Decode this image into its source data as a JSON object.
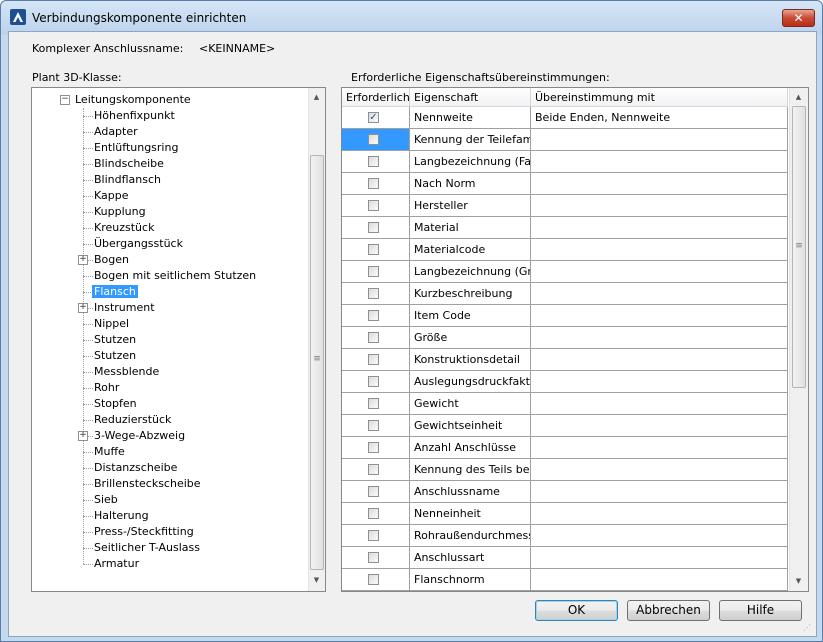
{
  "window": {
    "title": "Verbindungskomponente einrichten",
    "close_glyph": "✕",
    "app_icon": "autocad-plant-icon"
  },
  "header": {
    "name_label": "Komplexer Anschlussname:",
    "name_value": "<KEINNAME>"
  },
  "left_panel": {
    "label": "Plant 3D-Klasse:",
    "root": "Leitungskomponente",
    "items": [
      {
        "label": "Höhenfixpunkt",
        "expandable": false
      },
      {
        "label": "Adapter",
        "expandable": false
      },
      {
        "label": "Entlüftungsring",
        "expandable": false
      },
      {
        "label": "Blindscheibe",
        "expandable": false
      },
      {
        "label": "Blindflansch",
        "expandable": false
      },
      {
        "label": "Kappe",
        "expandable": false
      },
      {
        "label": "Kupplung",
        "expandable": false
      },
      {
        "label": "Kreuzstück",
        "expandable": false
      },
      {
        "label": "Übergangsstück",
        "expandable": false
      },
      {
        "label": "Bogen",
        "expandable": true
      },
      {
        "label": "Bogen mit seitlichem Stutzen",
        "expandable": false
      },
      {
        "label": "Flansch",
        "expandable": false,
        "selected": true
      },
      {
        "label": "Instrument",
        "expandable": true
      },
      {
        "label": "Nippel",
        "expandable": false
      },
      {
        "label": "Stutzen",
        "expandable": false
      },
      {
        "label": "Stutzen",
        "expandable": false
      },
      {
        "label": "Messblende",
        "expandable": false
      },
      {
        "label": "Rohr",
        "expandable": false
      },
      {
        "label": "Stopfen",
        "expandable": false
      },
      {
        "label": "Reduzierstück",
        "expandable": false
      },
      {
        "label": "3-Wege-Abzweig",
        "expandable": true
      },
      {
        "label": "Muffe",
        "expandable": false
      },
      {
        "label": "Distanzscheibe",
        "expandable": false
      },
      {
        "label": "Brillensteckscheibe",
        "expandable": false
      },
      {
        "label": "Sieb",
        "expandable": false
      },
      {
        "label": "Halterung",
        "expandable": false
      },
      {
        "label": "Press-/Steckfitting",
        "expandable": false
      },
      {
        "label": "Seitlicher T-Auslass",
        "expandable": false
      },
      {
        "label": "Armatur",
        "expandable": false
      }
    ]
  },
  "right_panel": {
    "label": "Erforderliche Eigenschaftsübereinstimmungen:",
    "columns": [
      "Erforderlich",
      "Eigenschaft",
      "Übereinstimmung mit"
    ],
    "rows": [
      {
        "required": true,
        "property": "Nennweite",
        "match": "Beide Enden, Nennweite"
      },
      {
        "required": false,
        "property": "Kennung der Teilefami...",
        "match": "",
        "selected": true
      },
      {
        "required": false,
        "property": "Langbezeichnung (Fa...",
        "match": ""
      },
      {
        "required": false,
        "property": "Nach Norm",
        "match": ""
      },
      {
        "required": false,
        "property": "Hersteller",
        "match": ""
      },
      {
        "required": false,
        "property": "Material",
        "match": ""
      },
      {
        "required": false,
        "property": "Materialcode",
        "match": ""
      },
      {
        "required": false,
        "property": "Langbezeichnung (Gr...",
        "match": ""
      },
      {
        "required": false,
        "property": "Kurzbeschreibung",
        "match": ""
      },
      {
        "required": false,
        "property": "Item Code",
        "match": ""
      },
      {
        "required": false,
        "property": "Größe",
        "match": ""
      },
      {
        "required": false,
        "property": "Konstruktionsdetail",
        "match": ""
      },
      {
        "required": false,
        "property": "Auslegungsdruckfaktor",
        "match": ""
      },
      {
        "required": false,
        "property": "Gewicht",
        "match": ""
      },
      {
        "required": false,
        "property": "Gewichtseinheit",
        "match": ""
      },
      {
        "required": false,
        "property": "Anzahl Anschlüsse",
        "match": ""
      },
      {
        "required": false,
        "property": "Kennung des Teils be...",
        "match": ""
      },
      {
        "required": false,
        "property": "Anschlussname",
        "match": ""
      },
      {
        "required": false,
        "property": "Nenneinheit",
        "match": ""
      },
      {
        "required": false,
        "property": "Rohraußendurchmesser",
        "match": ""
      },
      {
        "required": false,
        "property": "Anschlussart",
        "match": ""
      },
      {
        "required": false,
        "property": "Flanschnorm",
        "match": ""
      }
    ]
  },
  "buttons": {
    "ok": "OK",
    "cancel": "Abbrechen",
    "help": "Hilfe"
  },
  "scroll_glyphs": {
    "up": "▲",
    "down": "▼",
    "grip": "≡"
  }
}
